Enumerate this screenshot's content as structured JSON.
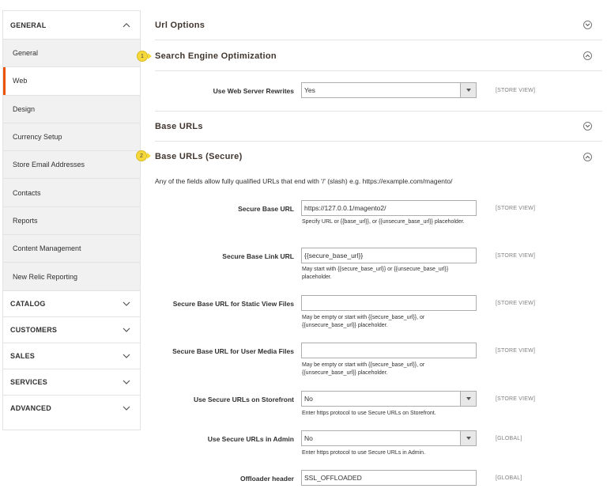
{
  "sidebar": {
    "general": {
      "label": "GENERAL",
      "items": [
        "General",
        "Web",
        "Design",
        "Currency Setup",
        "Store Email Addresses",
        "Contacts",
        "Reports",
        "Content Management",
        "New Relic Reporting"
      ],
      "active": "Web"
    },
    "groups": [
      "CATALOG",
      "CUSTOMERS",
      "SALES",
      "SERVICES",
      "ADVANCED"
    ],
    "accent": "#eb5202"
  },
  "sections": {
    "url_options": "Url Options",
    "seo": "Search Engine Optimization",
    "base_urls": "Base URLs",
    "base_urls_secure": "Base URLs (Secure)"
  },
  "badges": [
    "1",
    "2"
  ],
  "seo": {
    "rewrites_label": "Use Web Server Rewrites",
    "rewrites_value": "Yes",
    "rewrites_scope": "[STORE VIEW]"
  },
  "secure": {
    "description": "Any of the fields allow fully qualified URLs that end with '/' (slash) e.g. https://example.com/magento/",
    "fields": [
      {
        "label": "Secure Base URL",
        "value": "https://127.0.0.1/magento2/",
        "note": "Specify URL or {{base_url}}, or {{unsecure_base_url}} placeholder.",
        "scope": "[STORE VIEW]"
      },
      {
        "label": "Secure Base Link URL",
        "value": "{{secure_base_url}}",
        "note": "May start with {{secure_base_url}} or {{unsecure_base_url}} placeholder.",
        "scope": "[STORE VIEW]"
      },
      {
        "label": "Secure Base URL for Static View Files",
        "value": "",
        "note": "May be empty or start with {{secure_base_url}}, or {{unsecure_base_url}} placeholder.",
        "scope": "[STORE VIEW]"
      },
      {
        "label": "Secure Base URL for User Media Files",
        "value": "",
        "note": "May be empty or start with {{secure_base_url}}, or {{unsecure_base_url}} placeholder.",
        "scope": "[STORE VIEW]"
      },
      {
        "label": "Use Secure URLs on Storefront",
        "value": "No",
        "note": "Enter https protocol to use Secure URLs on Storefront.",
        "scope": "[STORE VIEW]"
      },
      {
        "label": "Use Secure URLs in Admin",
        "value": "No",
        "note": "Enter https protocol to use Secure URLs in Admin.",
        "scope": "[GLOBAL]"
      },
      {
        "label": "Offloader header",
        "value": "SSL_OFFLOADED",
        "note": "",
        "scope": "[GLOBAL]"
      }
    ]
  }
}
